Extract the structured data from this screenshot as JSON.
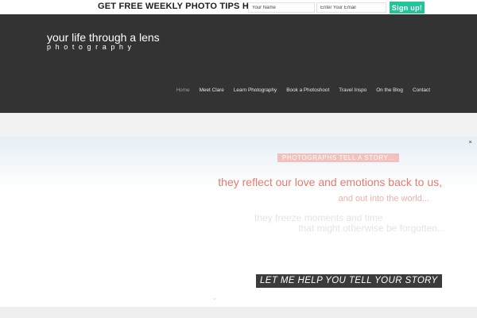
{
  "optin": {
    "title": "GET FREE WEEKLY PHOTO TIPS HERE",
    "name_placeholder": "Your Name",
    "email_placeholder": "Enter Your Email",
    "button_label": "Sign up!"
  },
  "header": {
    "logo_main": "your life through a lens",
    "logo_sub": "photography",
    "nav": [
      {
        "label": "Home",
        "active": true
      },
      {
        "label": "Meet Clare"
      },
      {
        "label": "Learn Photography"
      },
      {
        "label": "Book a Photoshoot"
      },
      {
        "label": "Travel Inspo"
      },
      {
        "label": "On the Blog"
      },
      {
        "label": "Contact"
      }
    ]
  },
  "hero": {
    "close_label": "×",
    "banner": "PHOTOGRAPHS TELL A STORY...",
    "line1": "they reflect our love and emotions back to us,",
    "line2": "and out into the world...",
    "line3": "they freeze moments and time",
    "line4": "that might otherwise be forgotten...",
    "cta": "LET ME HELP YOU TELL YOUR STORY",
    "chevron": "⌄"
  },
  "colors": {
    "header_bg": "#333334",
    "accent_green": "#24c39a",
    "coral": "#e57c6d",
    "banner_pink": "#f3c1bd"
  }
}
